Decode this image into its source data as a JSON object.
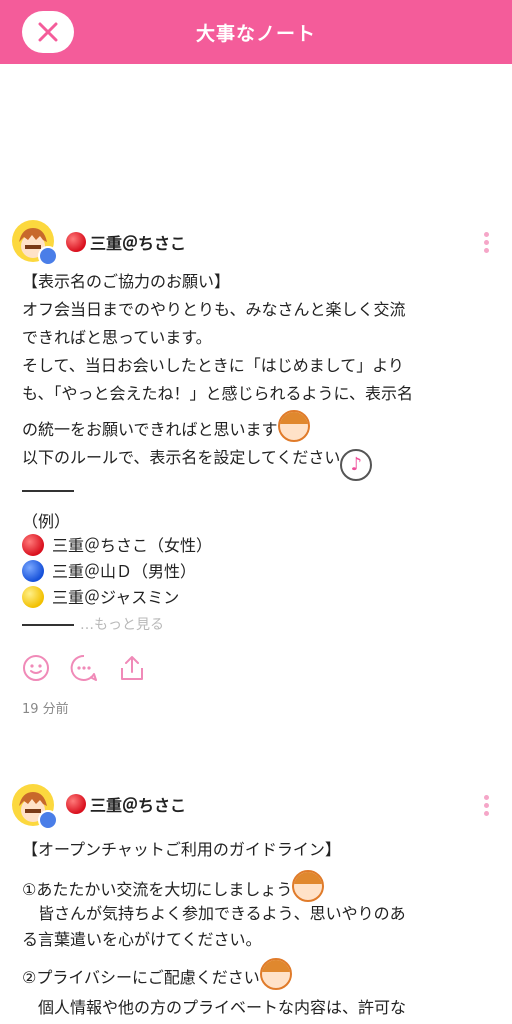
{
  "header": {
    "title": "大事なノート",
    "close_icon": "close-icon"
  },
  "post1": {
    "author": "三重＠ちさこ",
    "lines": [
      "【表示名のご協力のお願い】",
      "オフ会当日までのやりとりも、みなさんと楽しく交流",
      "できればと思っています。",
      "そして、当日お会いしたときに「はじめまして」より",
      "も、「やっと会えたね！」と感じられるように、表示名",
      "の統一をお願いできればと思います",
      "以下のルールで、表示名を設定してください"
    ],
    "example_label": "（例）",
    "examples": [
      "三重＠ちさこ（女性）",
      "三重＠山Ｄ（男性）",
      "三重＠ジャスミン"
    ],
    "see_more": "…もっと見る",
    "timestamp": "19 分前",
    "actions": [
      "smile-icon",
      "comment-icon",
      "share-icon"
    ]
  },
  "post2": {
    "author": "三重＠ちさこ",
    "lines": [
      "【オープンチャットご利用のガイドライン】",
      "①あたたかい交流を大切にしましょう",
      "　皆さんが気持ちよく参加できるよう、思いやりのあ",
      "る言葉遣いを心がけてください。",
      "②プライバシーにご配慮ください",
      "　個人情報や他の方のプライベートな内容は、許可な"
    ]
  },
  "colors": {
    "header_bg": "#f45c9a",
    "accent_pink": "#f08ab8",
    "avatar_bg": "#fcd83e",
    "badge_blue": "#4a7ee8"
  }
}
